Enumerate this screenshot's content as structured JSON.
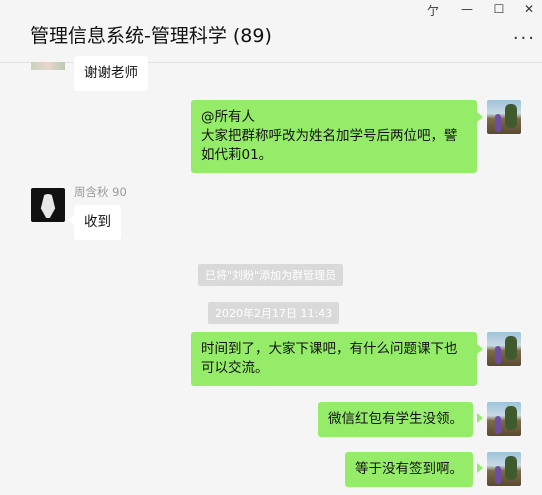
{
  "window": {
    "title": "管理信息系统-管理科学 (89)",
    "pin_glyph": "亇",
    "minimize_glyph": "—",
    "maximize_glyph": "☐",
    "close_glyph": "✕",
    "more_glyph": "···"
  },
  "messages": {
    "m0": {
      "text": "谢谢老师"
    },
    "m1": {
      "line1": "@所有人",
      "line2": "大家把群称呼改为姓名加学号后两位吧，譬",
      "line3": "如代莉01。"
    },
    "m2": {
      "nickname": "周含秋 90",
      "text": "收到"
    },
    "sys1": {
      "text": "已将\"刘盼\"添加为群管理员"
    },
    "time1": {
      "text": "2020年2月17日 11:43"
    },
    "m3": {
      "line1": "时间到了，大家下课吧，有什么问题课下也",
      "line2": "可以交流。"
    },
    "m4": {
      "text": "微信红包有学生没领。"
    },
    "m5": {
      "text": "等于没有签到啊。"
    }
  }
}
